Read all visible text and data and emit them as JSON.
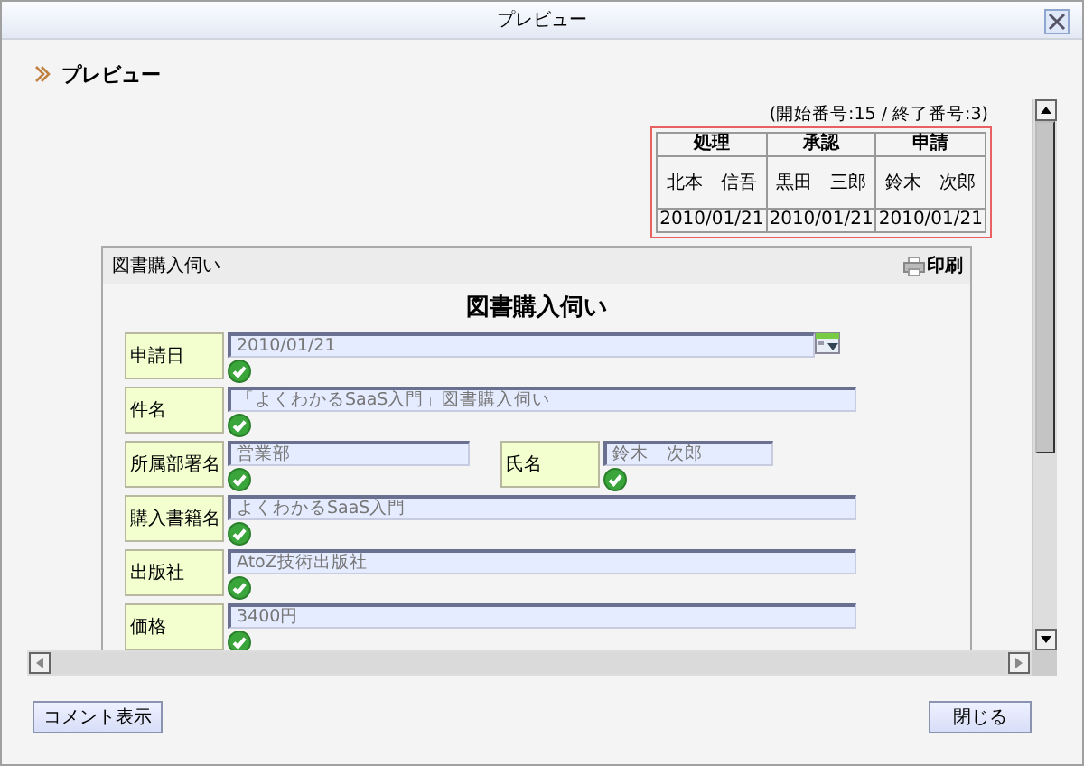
{
  "window": {
    "title": "プレビュー"
  },
  "heading": "プレビュー",
  "approval": {
    "range": "(開始番号:15 / 終了番号:3)",
    "columns": [
      {
        "header": "処理",
        "name": "北本　信吾",
        "date": "2010/01/21"
      },
      {
        "header": "承認",
        "name": "黒田　三郎",
        "date": "2010/01/21"
      },
      {
        "header": "申請",
        "name": "鈴木　次郎",
        "date": "2010/01/21"
      }
    ]
  },
  "form": {
    "panel_title": "図書購入伺い",
    "print": "印刷",
    "title": "図書購入伺い",
    "rows": [
      {
        "fields": [
          {
            "label": "申請日",
            "value": "2010/01/21",
            "kind": "date",
            "valid": true
          }
        ]
      },
      {
        "fields": [
          {
            "label": "件名",
            "value": "「よくわかるSaaS入門」図書購入伺い",
            "kind": "text",
            "valid": true
          }
        ]
      },
      {
        "fields": [
          {
            "label": "所属部署名",
            "value": "営業部",
            "kind": "text",
            "valid": true
          },
          {
            "label": "氏名",
            "value": "鈴木　次郎",
            "kind": "text",
            "valid": true
          }
        ]
      },
      {
        "fields": [
          {
            "label": "購入書籍名",
            "value": "よくわかるSaaS入門",
            "kind": "text",
            "valid": true
          }
        ]
      },
      {
        "fields": [
          {
            "label": "出版社",
            "value": "AtoZ技術出版社",
            "kind": "text",
            "valid": true
          }
        ]
      },
      {
        "fields": [
          {
            "label": "価格",
            "value": "3400円",
            "kind": "text",
            "valid": true
          }
        ]
      }
    ]
  },
  "buttons": [
    {
      "label": "コメント表示"
    },
    {
      "label": "閉じる"
    }
  ]
}
